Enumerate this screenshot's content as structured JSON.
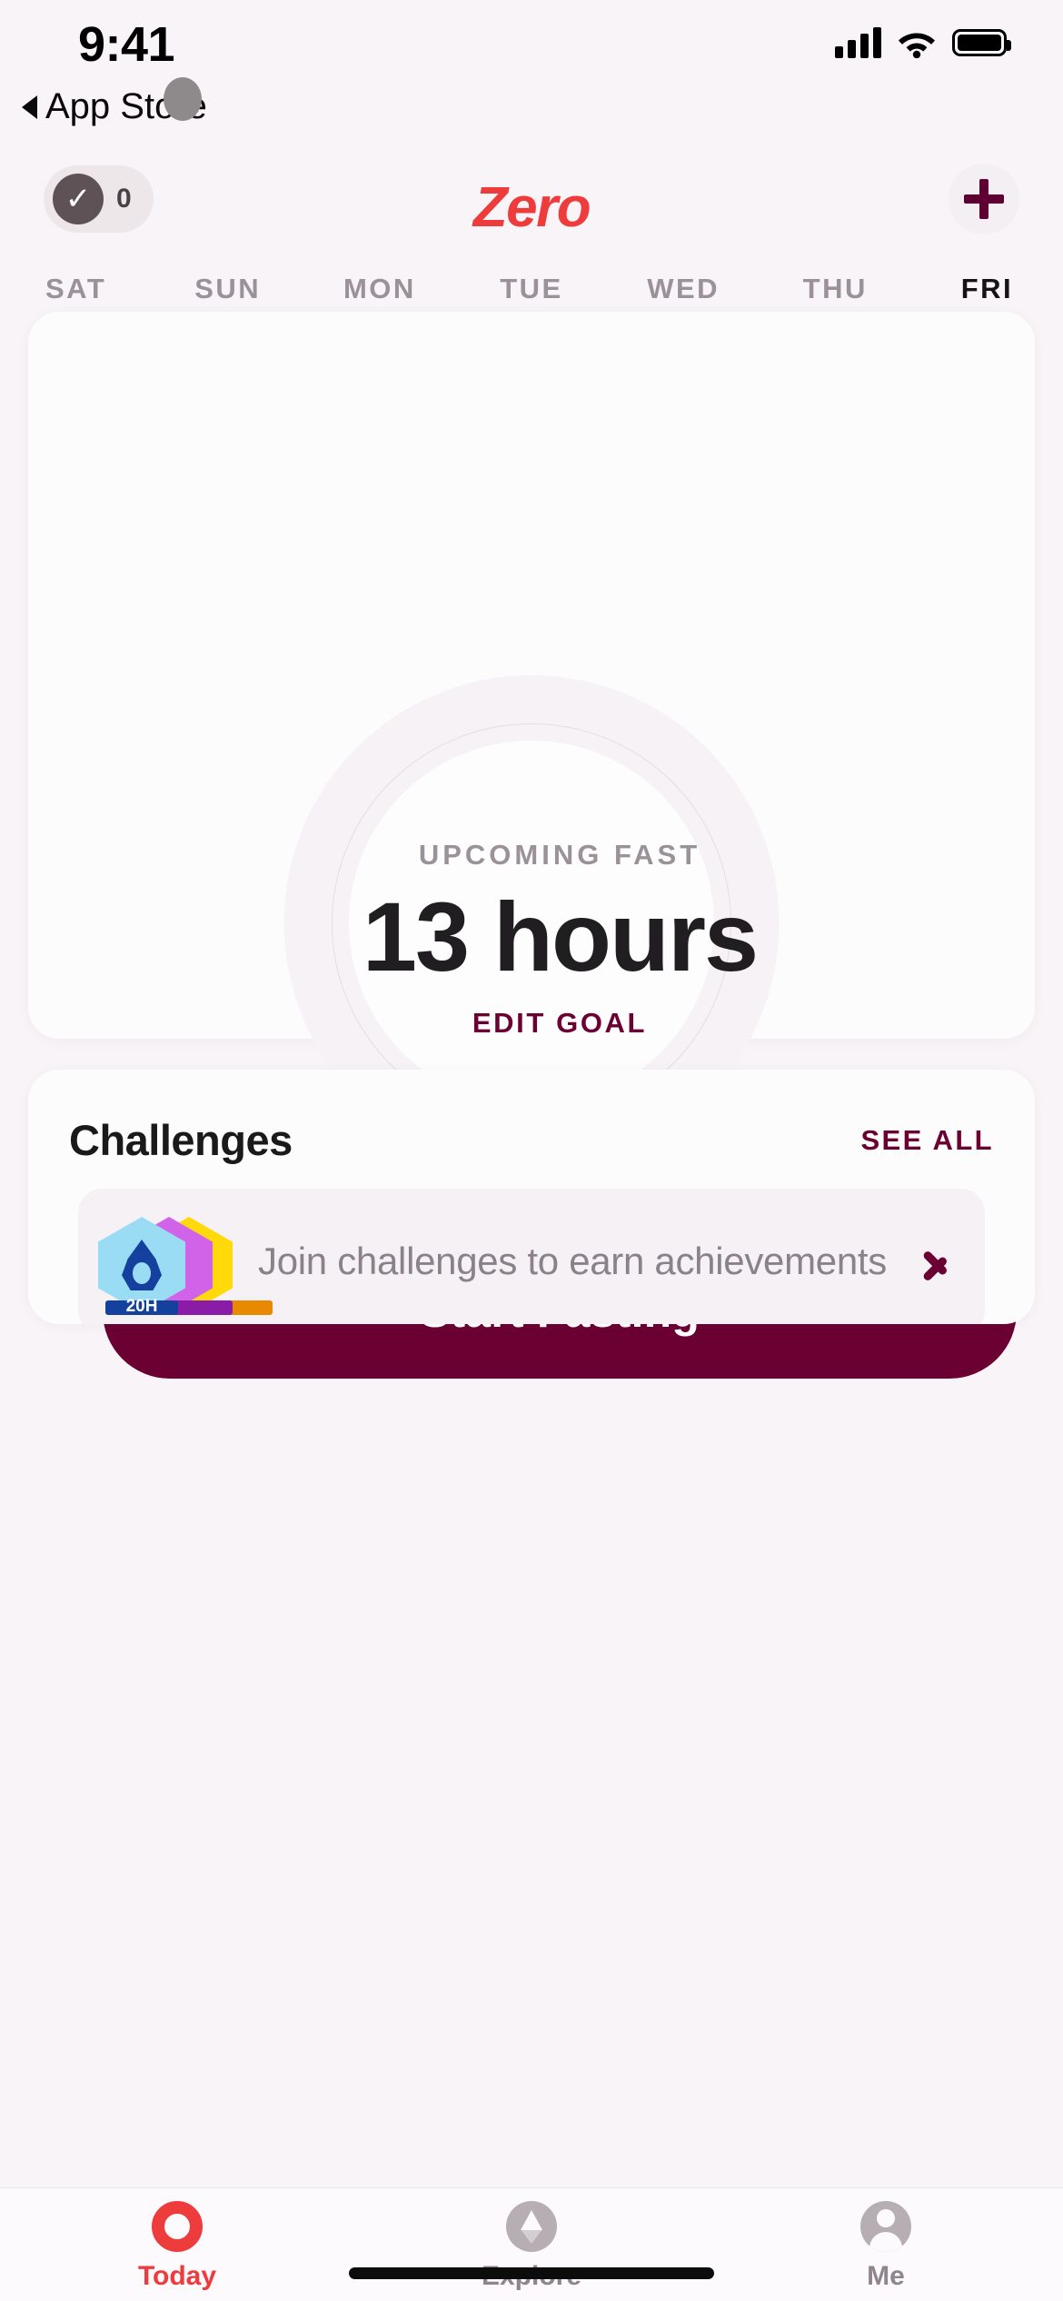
{
  "status_bar": {
    "time": "9:41",
    "back_label": "App Store",
    "icons": [
      "cellular-signal-icon",
      "wifi-icon",
      "battery-icon"
    ]
  },
  "navbar": {
    "streak_count": "0",
    "streak_icon": "check-circle-icon",
    "brand": "Zero",
    "add_icon": "plus-icon"
  },
  "week_strip": {
    "days": [
      {
        "label": "SAT",
        "today": false
      },
      {
        "label": "SUN",
        "today": false
      },
      {
        "label": "MON",
        "today": false
      },
      {
        "label": "TUE",
        "today": false
      },
      {
        "label": "WED",
        "today": false
      },
      {
        "label": "THU",
        "today": false
      },
      {
        "label": "FRI",
        "today": true
      }
    ]
  },
  "timer_card": {
    "kicker": "UPCOMING FAST",
    "duration": "13 hours",
    "edit_goal": "EDIT GOAL",
    "start_button": "Start Fasting"
  },
  "challenges": {
    "title": "Challenges",
    "see_all": "SEE ALL",
    "row": {
      "text": "Join challenges to earn achievements",
      "badge_hours": "20H",
      "chevron_icon": "chevron-right-icon"
    }
  },
  "tab_bar": {
    "tabs": [
      {
        "label": "Today",
        "icon": "today-ring-icon",
        "active": true
      },
      {
        "label": "Explore",
        "icon": "compass-icon",
        "active": false
      },
      {
        "label": "Me",
        "icon": "person-icon",
        "active": false
      }
    ]
  },
  "colors": {
    "background": "#F9F4F7",
    "brand_red": "#EE3B3B",
    "accent_maroon": "#6B0033",
    "card": "#FDFCFD",
    "muted_text": "#9B9198"
  }
}
